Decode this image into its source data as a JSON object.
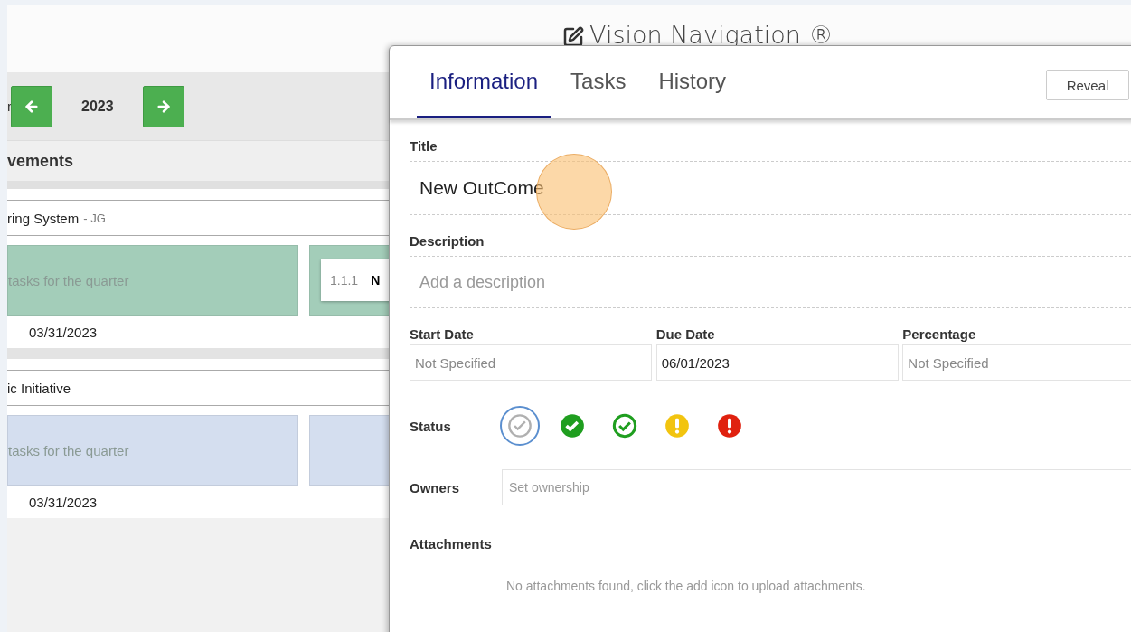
{
  "page_title": "Vision Navigation ®",
  "year_nav": {
    "label_fragment": "r",
    "year": "2023"
  },
  "section": {
    "title": "vements"
  },
  "groups": [
    {
      "title": "ring System",
      "owner": "- JG",
      "color": "#a3cdb9",
      "date": "03/31/2023",
      "tiles": [
        {
          "kind": "text",
          "text": "tasks for the quarter"
        },
        {
          "kind": "card",
          "code": "1.1.1",
          "name": "N"
        }
      ]
    },
    {
      "title": "ic Initiative",
      "color": "#d4deef",
      "date": "03/31/2023",
      "tiles": [
        {
          "kind": "text",
          "text": "tasks for the quarter"
        },
        {
          "kind": "empty"
        }
      ]
    }
  ],
  "dialog": {
    "tabs": [
      {
        "label": "Information",
        "selected": true
      },
      {
        "label": "Tasks",
        "selected": false
      },
      {
        "label": "History",
        "selected": false
      }
    ],
    "reveal_button": "Reveal",
    "title_field": {
      "label": "Title",
      "value": "New OutCome"
    },
    "description_field": {
      "label": "Description",
      "placeholder": "Add a description"
    },
    "date_fields": [
      {
        "label": "Start Date",
        "placeholder": "Not Specified"
      },
      {
        "label": "Due Date",
        "value": "06/01/2023"
      },
      {
        "label": "Percentage",
        "placeholder": "Not Specified"
      }
    ],
    "status": {
      "label": "Status",
      "options": [
        {
          "kind": "none",
          "color": "#b0b0b0",
          "selected": true
        },
        {
          "kind": "check-solid",
          "color": "#1f9e1f",
          "selected": false
        },
        {
          "kind": "check-outline",
          "color": "#1f9e1f",
          "selected": false
        },
        {
          "kind": "warning",
          "color": "#f2c40f",
          "selected": false
        },
        {
          "kind": "alert",
          "color": "#e0210f",
          "selected": false
        }
      ]
    },
    "owners": {
      "label": "Owners",
      "placeholder": "Set ownership"
    },
    "attachments": {
      "label": "Attachments",
      "message": "No attachments found, click the add icon to upload attachments."
    }
  }
}
